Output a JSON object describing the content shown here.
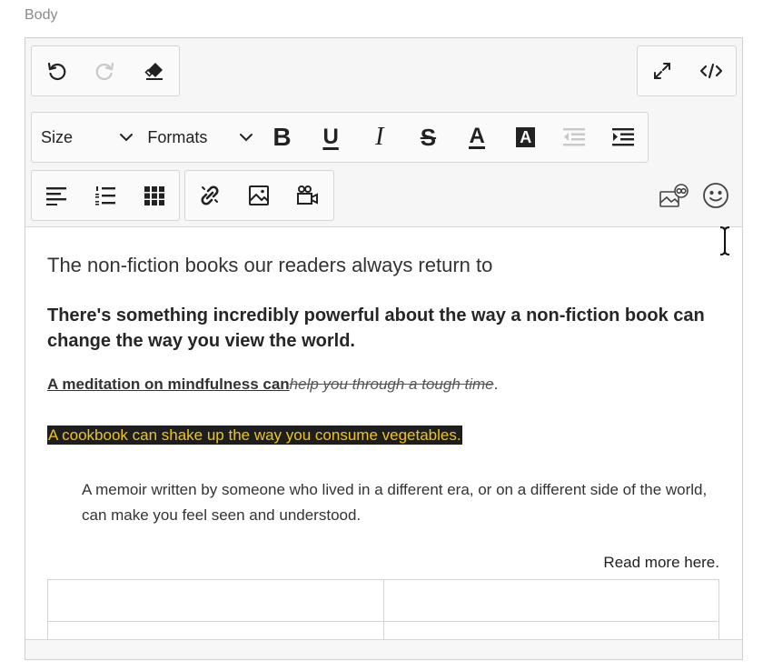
{
  "field": {
    "label": "Body"
  },
  "toolbar": {
    "size_label": "Size",
    "formats_label": "Formats",
    "bold_glyph": "B",
    "underline_glyph": "U",
    "italic_glyph": "I",
    "strike_glyph": "S",
    "textcolor_glyph": "A",
    "bgcolor_glyph": "A"
  },
  "content": {
    "heading": "The non-fiction books our readers always return to",
    "bold_paragraph": "There's something incredibly powerful about the way a non-fiction book can change the way you view the world.",
    "mixed_underlined": "A meditation on mindfulness can",
    "mixed_struck": "help you through a tough time",
    "mixed_end": ".",
    "highlighted": "A cookbook can shake up the way you consume vegetables.",
    "blockquote": "A memoir written by someone who lived in a different era, or on a different side of the world, can make you feel seen and understood.",
    "right_aligned": "Read more here."
  },
  "colors": {
    "highlight_bg": "#1e1e1e",
    "highlight_text": "#f0c419",
    "toolbar_bg": "#f6f6f6",
    "border": "#cfcfcf"
  }
}
